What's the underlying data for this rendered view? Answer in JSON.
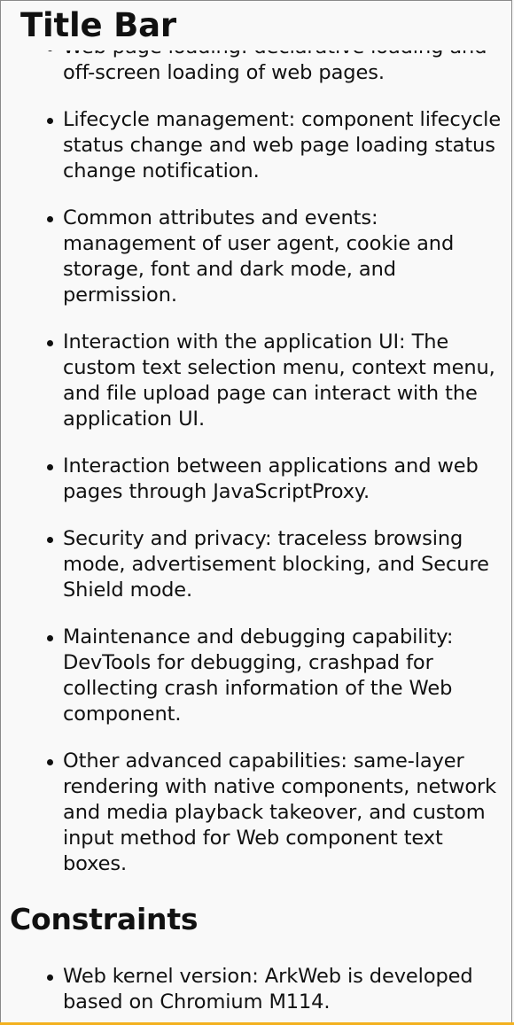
{
  "title_bar": {
    "title": "Title Bar"
  },
  "features": [
    "Web page loading: declarative loading and off-screen loading of web pages.",
    "Lifecycle management: component lifecycle status change and web page loading status change notification.",
    "Common attributes and events: management of user agent, cookie and storage, font and dark mode, and permission.",
    "Interaction with the application UI: The custom text selection menu, context menu, and file upload page can interact with the application UI.",
    "Interaction between applications and web pages through JavaScriptProxy.",
    "Security and privacy: traceless browsing mode, advertisement blocking, and Secure Shield mode.",
    "Maintenance and debugging capability: DevTools for debugging, crashpad for collecting crash information of the Web component.",
    "Other advanced capabilities: same-layer rendering with native components, network and media playback takeover, and custom input method for Web component text boxes."
  ],
  "constraints": {
    "heading": "Constraints",
    "items": [
      "Web kernel version: ArkWeb is developed based on Chromium M114."
    ]
  },
  "colors": {
    "background": "#f9f9f9",
    "text": "#111111",
    "border": "#8a8a8a",
    "bottom_accent": "#f3b11e"
  }
}
